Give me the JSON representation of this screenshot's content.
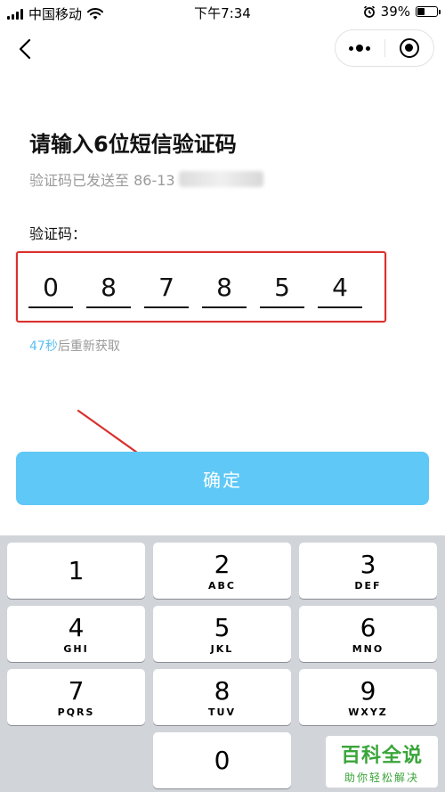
{
  "status_bar": {
    "carrier": "中国移动",
    "time": "下午7:34",
    "battery_percent": "39%",
    "battery_level": 0.39,
    "icons": [
      "signal-icon",
      "wifi-icon",
      "alarm-icon",
      "battery-icon"
    ]
  },
  "nav": {
    "back_icon": "chevron-left-icon",
    "more_icon": "more-dots-icon",
    "close_icon": "target-icon"
  },
  "main": {
    "title": "请输入6位短信验证码",
    "sent_to_prefix": "验证码已发送至 86-13",
    "code_label": "验证码：",
    "code_digits": [
      "0",
      "8",
      "7",
      "8",
      "5",
      "4"
    ],
    "resend_seconds": "47秒",
    "resend_suffix": "后重新获取",
    "confirm_label": "确定"
  },
  "colors": {
    "accent_button": "#5fc8f6",
    "countdown": "#5bc0f0",
    "highlight_box": "#d9302c",
    "watermark": "#3aa53a"
  },
  "keyboard": {
    "keys": [
      {
        "num": "1",
        "letters": ""
      },
      {
        "num": "2",
        "letters": "ABC"
      },
      {
        "num": "3",
        "letters": "DEF"
      },
      {
        "num": "4",
        "letters": "GHI"
      },
      {
        "num": "5",
        "letters": "JKL"
      },
      {
        "num": "6",
        "letters": "MNO"
      },
      {
        "num": "7",
        "letters": "PQRS"
      },
      {
        "num": "8",
        "letters": "TUV"
      },
      {
        "num": "9",
        "letters": "WXYZ"
      },
      {
        "num": "0",
        "letters": ""
      }
    ]
  },
  "watermark": {
    "main": "百科全说",
    "sub": "助你轻松解决"
  }
}
